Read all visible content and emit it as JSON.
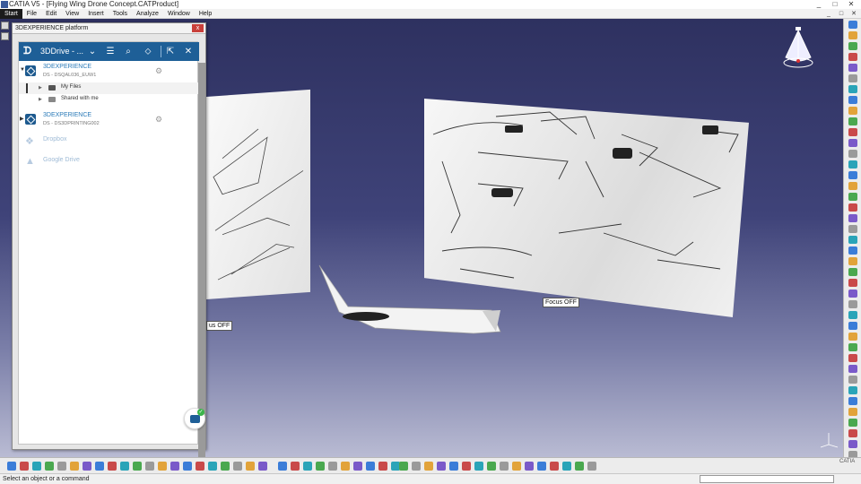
{
  "window": {
    "title": "CATIA V5 - [Flying Wing Drone Concept.CATProduct]",
    "minimize": "_",
    "maximize": "□",
    "close": "✕"
  },
  "menu": {
    "items": [
      "Start",
      "File",
      "Edit",
      "View",
      "Insert",
      "Tools",
      "Analyze",
      "Window",
      "Help"
    ]
  },
  "panel": {
    "title": "3DEXPERIENCE platform",
    "close": "x",
    "drive": {
      "title": "3DDrive - ..."
    },
    "tree": {
      "root1": {
        "name": "3DEXPERIENCE",
        "subtitle": "DS - DSQAL036_EUW1",
        "children": [
          "My Files",
          "Shared with me"
        ]
      },
      "root2": {
        "name": "3DEXPERIENCE",
        "subtitle": "DS - DS3DPRINTING002"
      },
      "services": [
        "Dropbox",
        "Google Drive"
      ]
    }
  },
  "viewport": {
    "focus_right": "Focus OFF",
    "focus_left": "us OFF"
  },
  "statusbar": {
    "message": "Select an object or a command"
  },
  "icons": {
    "search": "search-icon",
    "menu": "hamburger-icon",
    "tag": "tag-icon",
    "open": "open-external-icon",
    "close": "close-icon"
  },
  "colors": {
    "drive_header": "#1e5f97",
    "viewport_top": "#2e3160",
    "link_blue": "#2a7ab8"
  }
}
